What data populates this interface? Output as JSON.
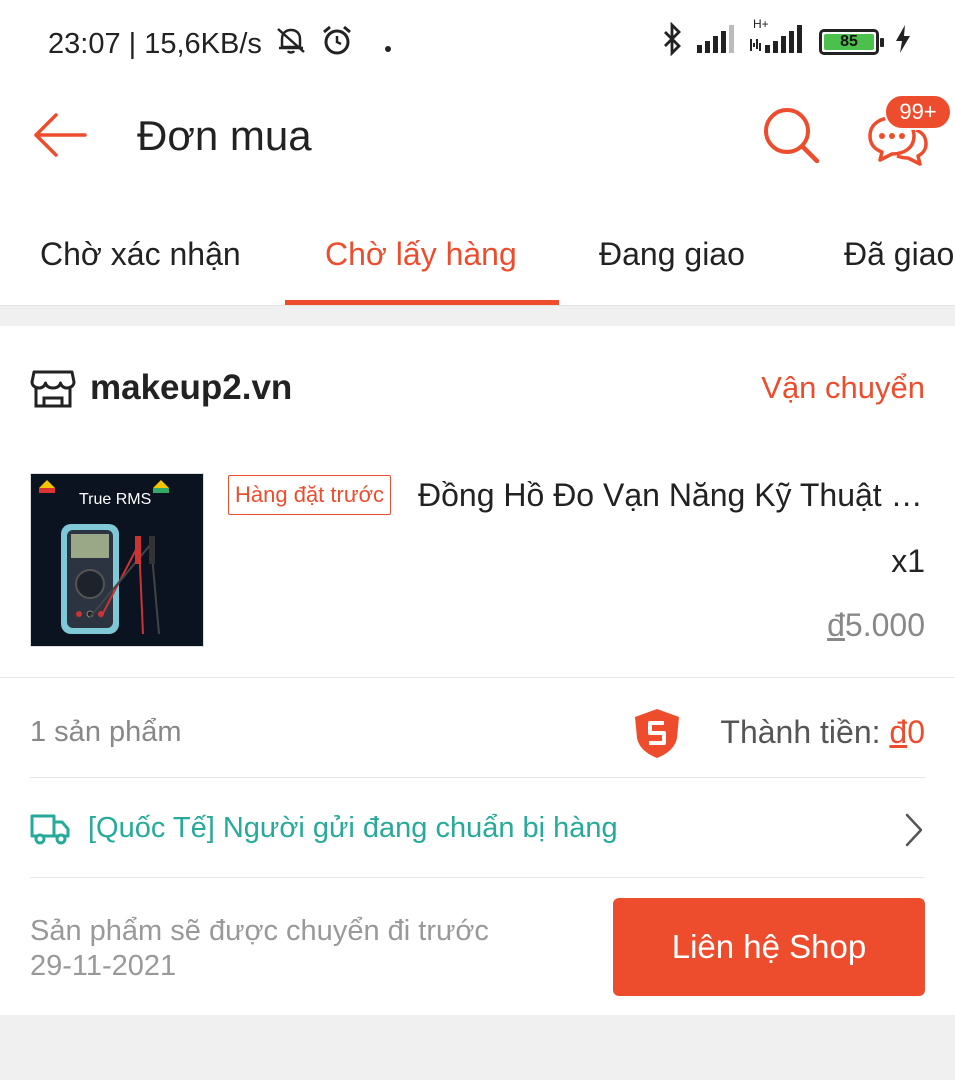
{
  "status_bar": {
    "time_speed": "23:07 | 15,6KB/s",
    "network_type": "H+",
    "battery_level": "85",
    "icons": [
      "notifications-muted-icon",
      "alarm-icon",
      "dot-icon",
      "bluetooth-icon",
      "signal-icon",
      "signal-icon",
      "charging-icon"
    ]
  },
  "header": {
    "title": "Đơn mua",
    "chat_badge": "99+",
    "icons": [
      "back-arrow-icon",
      "search-icon",
      "chat-icon"
    ]
  },
  "tabs": [
    {
      "label": "Chờ xác nhận",
      "active": false
    },
    {
      "label": "Chờ lấy hàng",
      "active": true
    },
    {
      "label": "Đang giao",
      "active": false
    },
    {
      "label": "Đã giao",
      "active": false
    }
  ],
  "order": {
    "shop_name": "makeup2.vn",
    "shipping_status": "Vận chuyển",
    "product": {
      "tag": "Hàng đặt trước",
      "name": "Đồng Hồ Đo Vạn Năng Kỹ Thuật Số",
      "quantity": "x1",
      "price_currency": "đ",
      "price_value": "5.000",
      "image_label": "True RMS"
    },
    "item_count": "1 sản phẩm",
    "total_label": "Thành tiền: ",
    "total_currency": "đ",
    "total_value": "0",
    "tracking_text": "[Quốc Tế] Người gửi đang chuẩn bị hàng",
    "ship_note_line1": "Sản phẩm sẽ được chuyển đi trước",
    "ship_note_line2": "29-11-2021",
    "contact_button": "Liên hệ Shop"
  },
  "colors": {
    "accent": "#ee4d2d",
    "tracking": "#26aa99",
    "battery": "#4cc04c"
  }
}
